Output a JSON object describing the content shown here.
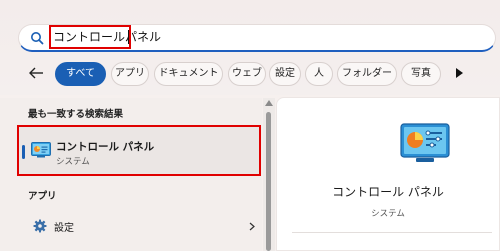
{
  "search": {
    "query": "コントロールパネル"
  },
  "filters": {
    "items": [
      {
        "label": "すべて",
        "active": true
      },
      {
        "label": "アプリ",
        "active": false
      },
      {
        "label": "ドキュメント",
        "active": false
      },
      {
        "label": "ウェブ",
        "active": false
      },
      {
        "label": "設定",
        "active": false
      },
      {
        "label": "人",
        "active": false
      },
      {
        "label": "フォルダー",
        "active": false
      },
      {
        "label": "写真",
        "active": false
      }
    ]
  },
  "results": {
    "best_match_heading": "最も一致する検索結果",
    "best_match": {
      "title": "コントロール パネル",
      "subtitle": "システム",
      "icon": "control-panel-icon"
    },
    "apps_heading": "アプリ",
    "apps": [
      {
        "label": "設定",
        "icon": "gear-icon"
      }
    ]
  },
  "preview": {
    "title": "コントロール パネル",
    "subtitle": "システム",
    "icon": "control-panel-icon"
  },
  "colors": {
    "accent": "#1a5fb4",
    "highlight_box": "#e00000"
  }
}
